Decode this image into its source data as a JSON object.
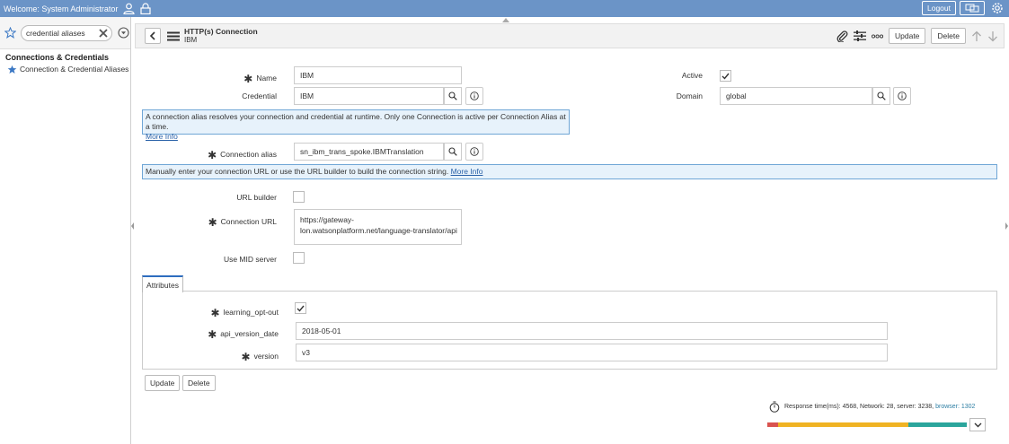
{
  "banner": {
    "welcome": "Welcome: System Administrator",
    "logout": "Logout"
  },
  "nav": {
    "filter_value": "credential aliases",
    "section": "Connections & Credentials",
    "item": "Connection & Credential Aliases"
  },
  "header": {
    "title": "HTTP(s) Connection",
    "subtitle": "IBM",
    "update": "Update",
    "delete": "Delete"
  },
  "form": {
    "name_label": "Name",
    "name_value": "IBM",
    "credential_label": "Credential",
    "credential_value": "IBM",
    "active_label": "Active",
    "domain_label": "Domain",
    "domain_value": "global",
    "alias_info": "A connection alias resolves your connection and credential at runtime. Only one Connection is active per Connection Alias at a time.",
    "more_info": "More Info",
    "alias_label": "Connection alias",
    "alias_value": "sn_ibm_trans_spoke.IBMTranslation",
    "url_info": "Manually enter your connection URL or use the URL builder to build the connection string.",
    "url_builder_label": "URL builder",
    "url_label": "Connection URL",
    "url_value": "https://gateway-lon.watsonplatform.net/language-translator/api",
    "mid_label": "Use MID server"
  },
  "attributes": {
    "tab": "Attributes",
    "learning_label": "learning_opt-out",
    "api_label": "api_version_date",
    "api_value": "2018-05-01",
    "version_label": "version",
    "version_value": "v3"
  },
  "footer": {
    "update": "Update",
    "delete": "Delete",
    "response_prefix": "Response time(ms): 4568, Network: 28, server: 3238,",
    "browser": "browser: 1302"
  },
  "colors": {
    "banner": "#6b94c7",
    "bar_network": "#d9534f",
    "bar_server": "#f0b323",
    "bar_browser": "#2ba59c"
  }
}
